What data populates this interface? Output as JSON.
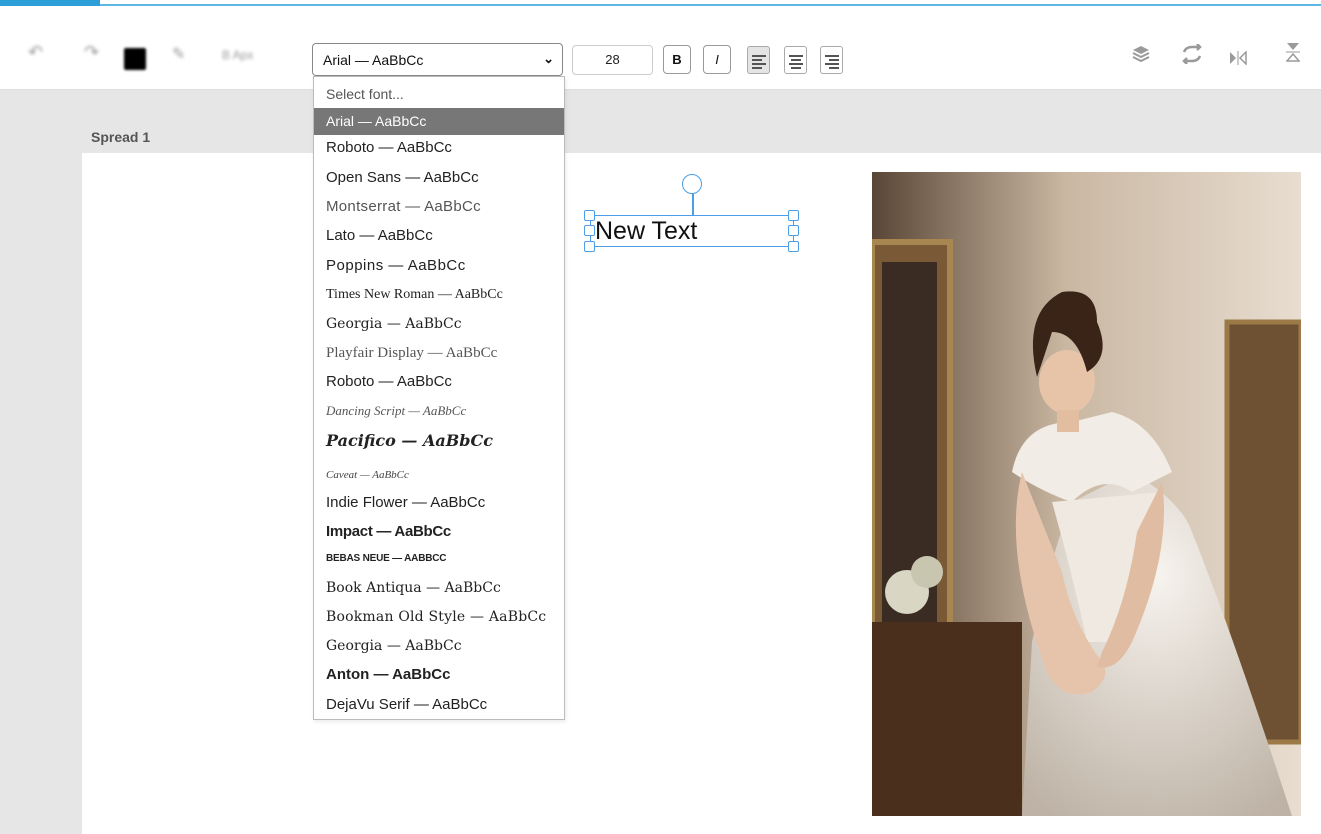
{
  "toolbar": {
    "undo_icon": "undo-icon",
    "redo_icon": "redo-icon",
    "color_swatch": "#000000",
    "blurred_label": "B Apx",
    "font_select_value": "Arial — AaBbCc",
    "font_size_value": "28",
    "bold_label": "B",
    "italic_label": "I",
    "align_active": "left",
    "right_icons": [
      "layers-icon",
      "sync-icon",
      "flip-horizontal-icon",
      "flip-vertical-icon"
    ]
  },
  "canvas": {
    "spread_label": "Spread 1",
    "text_box_value": "New Text",
    "selection_color": "#4d9ee6"
  },
  "font_dropdown": {
    "placeholder": "Select font...",
    "selected_index": 0,
    "items": [
      "Arial — AaBbCc",
      "Roboto — AaBbCc",
      "Open Sans — AaBbCc",
      "Montserrat — AaBbCc",
      "Lato — AaBbCc",
      "Poppins — AaBbCc",
      "Times New Roman — AaBbCc",
      "Georgia — AaBbCc",
      "Playfair Display — AaBbCc",
      "Roboto — AaBbCc",
      "Dancing Script — AaBbCc",
      "Pacifico — AaBbCc",
      "Caveat — AaBbCc",
      "Indie Flower — AaBbCc",
      "Impact — AaBbCc",
      "BEBAS NEUE — AABBCC",
      "Book Antiqua — AaBbCc",
      "Bookman Old Style — AaBbCc",
      "Georgia — AaBbCc",
      "Anton — AaBbCc",
      "DejaVu Serif — AaBbCc"
    ]
  },
  "colors": {
    "accent": "#2d9fd8",
    "dropdown_selected_bg": "#777777"
  }
}
